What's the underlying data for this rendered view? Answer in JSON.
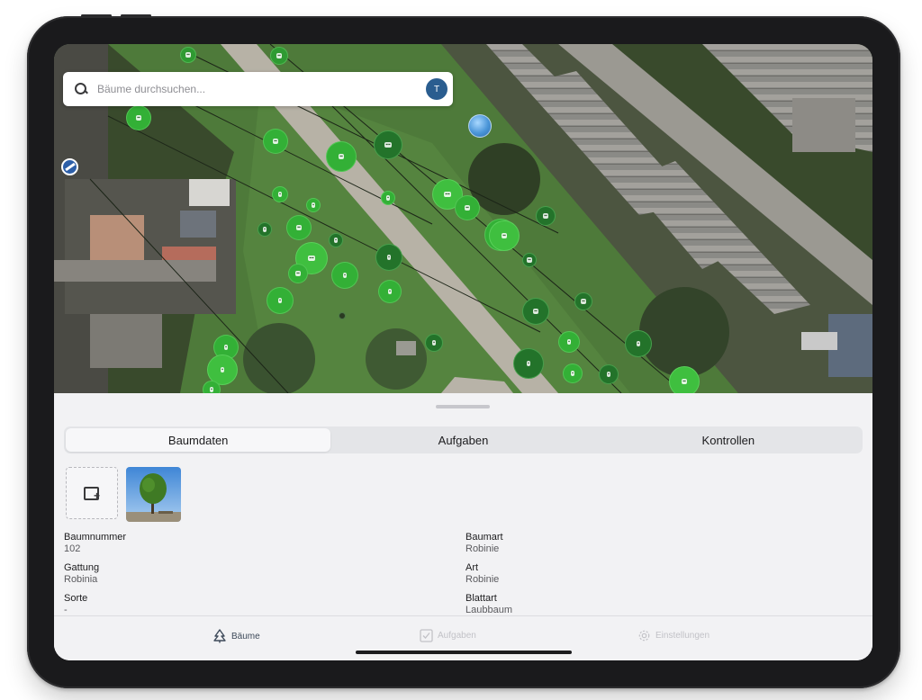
{
  "search": {
    "placeholder": "Bäume durchsuchen...",
    "avatar_initial": "T"
  },
  "detail_tabs": [
    {
      "label": "Baumdaten",
      "active": true
    },
    {
      "label": "Aufgaben",
      "active": false
    },
    {
      "label": "Kontrollen",
      "active": false
    }
  ],
  "tree": {
    "left_fields": [
      {
        "label": "Baumnummer",
        "value": "102"
      },
      {
        "label": "Gattung",
        "value": "Robinia"
      },
      {
        "label": "Sorte",
        "value": "-"
      }
    ],
    "right_fields": [
      {
        "label": "Baumart",
        "value": "Robinie"
      },
      {
        "label": "Art",
        "value": "Robinie"
      },
      {
        "label": "Blattart",
        "value": "Laubbaum"
      }
    ]
  },
  "tab_bar": [
    {
      "label": "Bäume",
      "icon": "tree-icon",
      "active": true
    },
    {
      "label": "Aufgaben",
      "icon": "checkbox-icon",
      "active": false
    },
    {
      "label": "Einstellungen",
      "icon": "gear-icon",
      "active": false
    }
  ],
  "colors": {
    "marker_light": "#3fbf3f",
    "marker_dark": "#1e7a2a",
    "avatar": "#2a5d8f",
    "active_tab": "#3e4a5a"
  }
}
